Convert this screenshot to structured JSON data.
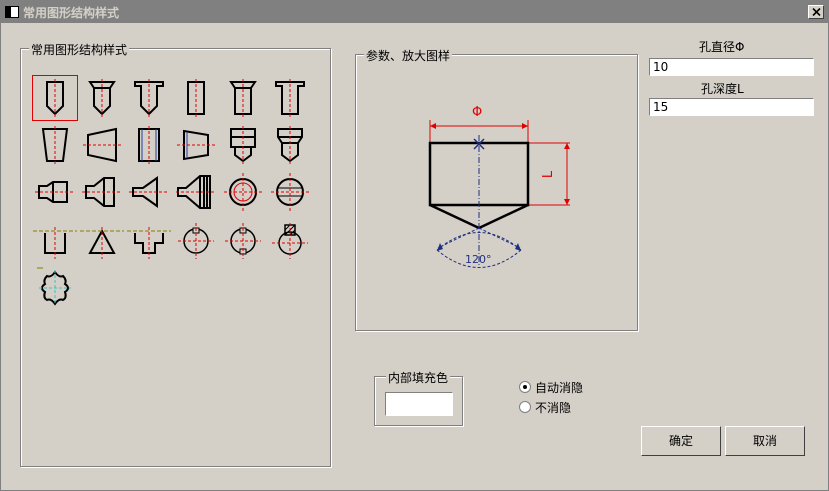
{
  "window": {
    "title": "常用图形结构样式"
  },
  "styles_group": {
    "label": "常用图形结构样式"
  },
  "preview_group": {
    "label": "参数、放大图样",
    "dim_phi": "Φ",
    "dim_l": "L",
    "angle": "120°"
  },
  "params": {
    "diameter_label": "孔直径Φ",
    "diameter_value": "10",
    "depth_label": "孔深度L",
    "depth_value": "15"
  },
  "fill_group": {
    "label": "内部填充色",
    "swatch_color": "#ffffff"
  },
  "hide_options": [
    {
      "label": "自动消隐",
      "selected": true
    },
    {
      "label": "不消隐",
      "selected": false
    }
  ],
  "buttons": {
    "ok": "确定",
    "cancel": "取消"
  }
}
